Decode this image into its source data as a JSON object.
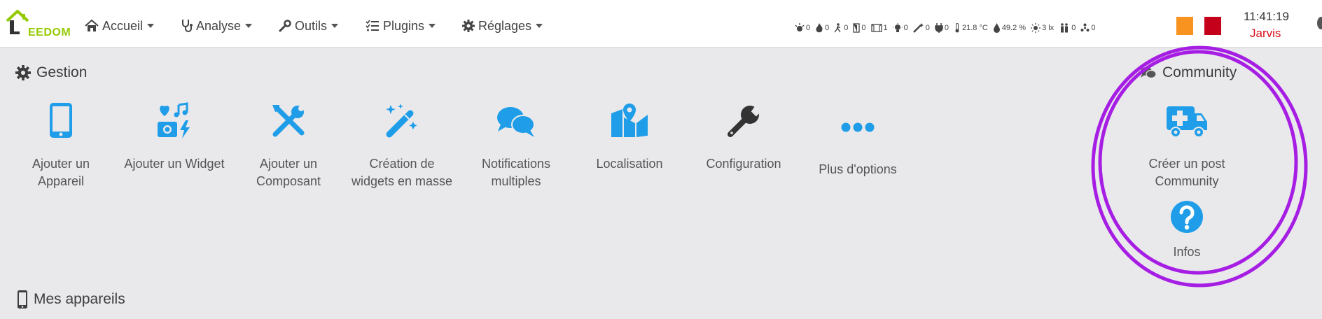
{
  "app": {
    "logo_text": "EEDOM"
  },
  "nav": [
    {
      "label": "Accueil",
      "icon": "home-icon"
    },
    {
      "label": "Analyse",
      "icon": "stethoscope-icon"
    },
    {
      "label": "Outils",
      "icon": "wrench-icon"
    },
    {
      "label": "Plugins",
      "icon": "tasks-icon"
    },
    {
      "label": "Réglages",
      "icon": "gear-icon"
    }
  ],
  "status": [
    {
      "icon": "alarm-icon",
      "value": "0"
    },
    {
      "icon": "flame-icon",
      "value": "0"
    },
    {
      "icon": "walk-icon",
      "value": "0"
    },
    {
      "icon": "door-icon",
      "value": "0"
    },
    {
      "icon": "window-icon",
      "value": "1"
    },
    {
      "icon": "light-icon",
      "value": "0"
    },
    {
      "icon": "magic-icon",
      "value": "0"
    },
    {
      "icon": "plug-icon",
      "value": "0"
    },
    {
      "icon": "thermometer-icon",
      "value": "21.8 °C"
    },
    {
      "icon": "humidity-icon",
      "value": "49.2 %"
    },
    {
      "icon": "luminosity-icon",
      "value": "3 lx"
    },
    {
      "icon": "people-icon",
      "value": "0"
    },
    {
      "icon": "fan-icon",
      "value": "0"
    }
  ],
  "header_right": {
    "time": "11:41:19",
    "user": "Jarvis",
    "orange": "#f7931e",
    "red": "#c4001a"
  },
  "gestion": {
    "title": "Gestion",
    "items": [
      {
        "label_1": "Ajouter un",
        "label_2": "Appareil",
        "icon": "mobile-icon"
      },
      {
        "label_1": "Ajouter un Widget",
        "label_2": "",
        "icon": "widget-icon"
      },
      {
        "label_1": "Ajouter un",
        "label_2": "Composant",
        "icon": "tools-icon"
      },
      {
        "label_1": "Création de",
        "label_2": "widgets en masse",
        "icon": "magic-wand-icon"
      },
      {
        "label_1": "Notifications",
        "label_2": "multiples",
        "icon": "comments-icon"
      },
      {
        "label_1": "Localisation",
        "label_2": "",
        "icon": "map-icon"
      },
      {
        "label_1": "Configuration",
        "label_2": "",
        "icon": "wrench-icon"
      },
      {
        "label_1": "Plus d'options",
        "label_2": "",
        "icon": "ellipsis-icon"
      }
    ]
  },
  "community": {
    "title": "Community",
    "items": [
      {
        "label_1": "Créer un post",
        "label_2": "Community",
        "icon": "ambulance-icon"
      },
      {
        "label_1": "Infos",
        "label_2": "",
        "icon": "question-circle-icon"
      }
    ]
  },
  "devices": {
    "title": "Mes appareils"
  },
  "colors": {
    "accent": "#1f9de8",
    "dark_icon": "#333333",
    "annotation": "#a61ee3"
  }
}
